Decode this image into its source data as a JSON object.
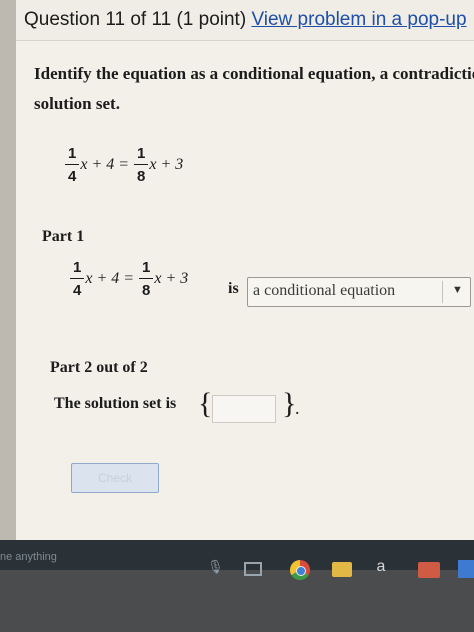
{
  "header": {
    "question_label": "Question 11 of 11 (1 point)",
    "popup_link": "View problem in a pop-up"
  },
  "prompt": {
    "line1": "Identify the equation as a conditional equation, a contradiction, or an identity. Then give the",
    "line2": "solution set."
  },
  "equation": {
    "left_num": "1",
    "left_den": "4",
    "left_rest": "x + 4 =",
    "right_num": "1",
    "right_den": "8",
    "right_rest": "x + 3"
  },
  "part1": {
    "label": "Part 1",
    "is_word": "is",
    "selected_option": "a conditional equation"
  },
  "part2": {
    "label": "Part 2 out of 2",
    "solution_text": "The solution set is",
    "open_brace": "{",
    "close_brace": "}",
    "period": ".",
    "answer_value": ""
  },
  "check_button": {
    "label": "Check"
  },
  "taskbar": {
    "search_placeholder": "ne anything",
    "amazon_glyph": "a"
  },
  "icons": {
    "dropdown": "chevron-down-icon",
    "microphone": "microphone-icon",
    "task_view": "task-view-icon",
    "chrome": "chrome-icon",
    "file_explorer": "folder-icon",
    "amazon": "amazon-icon",
    "camera": "camera-icon",
    "store": "store-icon"
  }
}
